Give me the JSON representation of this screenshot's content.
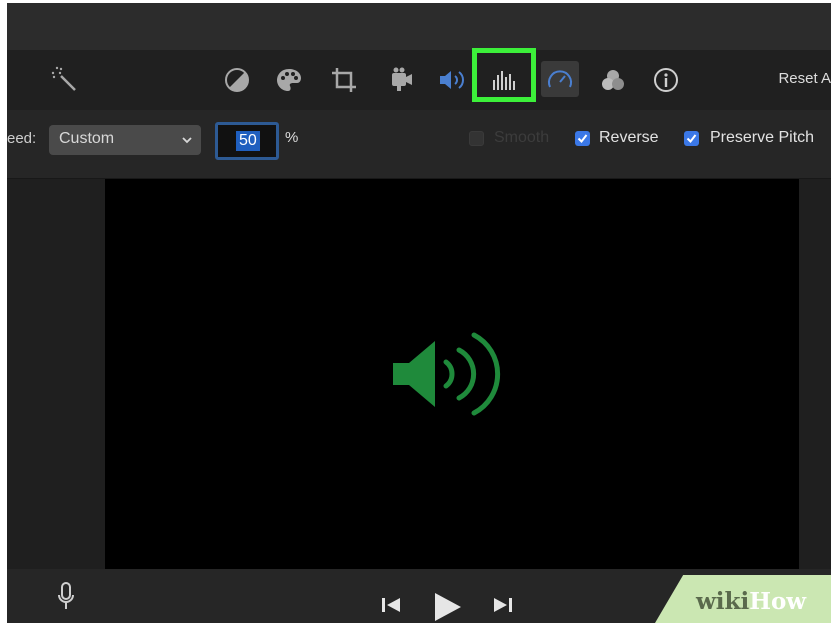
{
  "toolbar": {
    "reset_label": "Reset A",
    "icons": [
      "magic-wand-icon",
      "color-balance-icon",
      "color-palette-icon",
      "crop-icon",
      "stabilization-camera-icon",
      "volume-icon",
      "equalizer-icon",
      "speed-gauge-icon",
      "filter-circles-icon",
      "info-icon"
    ]
  },
  "speed": {
    "label": "eed:",
    "selected": "Custom",
    "value": "50",
    "unit": "%",
    "smooth_label": "Smooth",
    "smooth_checked": false,
    "reverse_label": "Reverse",
    "reverse_checked": true,
    "preserve_pitch_label": "Preserve Pitch",
    "preserve_pitch_checked": true
  },
  "viewer": {
    "overlay_icon": "speaker-icon",
    "overlay_color": "#1f8a3b"
  },
  "playback": {
    "icons": [
      "microphone-icon",
      "skip-back-icon",
      "play-icon",
      "skip-forward-icon"
    ]
  },
  "watermark": {
    "part1": "wiki",
    "part2": "How"
  },
  "colors": {
    "highlight": "#3cf03a",
    "accent": "#3b78e7"
  }
}
